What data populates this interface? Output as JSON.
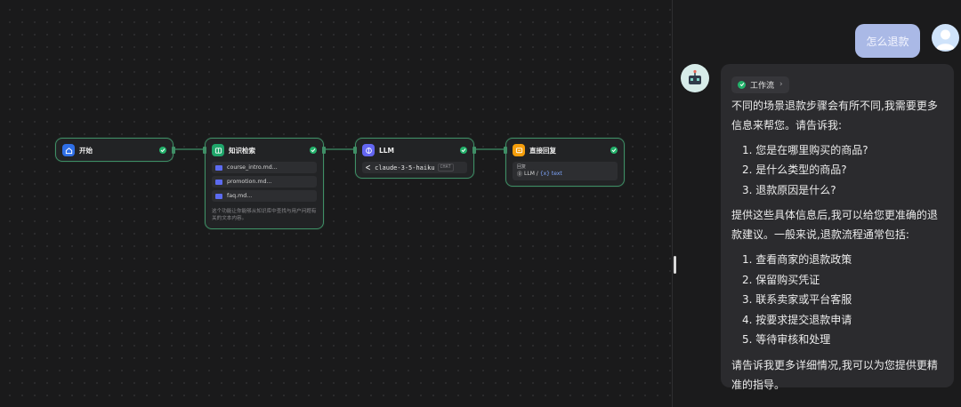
{
  "canvas": {
    "nodes": {
      "start": {
        "title": "开始"
      },
      "knowledge": {
        "title": "知识检索",
        "files": [
          "course_intro.md...",
          "promotion.md...",
          "faq.md..."
        ],
        "description": "这个功能让你能够从知识库中查找与用户问题有关的文本内容。"
      },
      "llm": {
        "title": "LLM",
        "model": "claude-3-5-haiku",
        "mode_tag": "CHAT"
      },
      "reply": {
        "title": "直接回复",
        "field_label": "回复",
        "source": "LLM /",
        "variable": "{x} text"
      }
    }
  },
  "chat": {
    "user_message": "怎么退款",
    "workflow_label": "工作流",
    "answer": {
      "intro": "不同的场景退款步骤会有所不同,我需要更多信息来帮您。请告诉我:",
      "questions": [
        "1. 您是在哪里购买的商品?",
        "2. 是什么类型的商品?",
        "3. 退款原因是什么?"
      ],
      "middle": "提供这些具体信息后,我可以给您更准确的退款建议。一般来说,退款流程通常包括:",
      "steps": [
        "1. 查看商家的退款政策",
        "2. 保留购买凭证",
        "3. 联系卖家或平台客服",
        "4. 按要求提交退款申请",
        "5. 等待审核和处理"
      ],
      "outro": "请告诉我更多详细情况,我可以为您提供更精准的指导。"
    }
  },
  "colors": {
    "node_border": "#3f8f66",
    "check_green": "#23b26b",
    "user_bubble": "#aab9e6",
    "start_icon": "#2f6fe6",
    "knowledge_icon": "#1fa56a",
    "llm_icon": "#6366f1",
    "reply_icon": "#f59e0b"
  }
}
